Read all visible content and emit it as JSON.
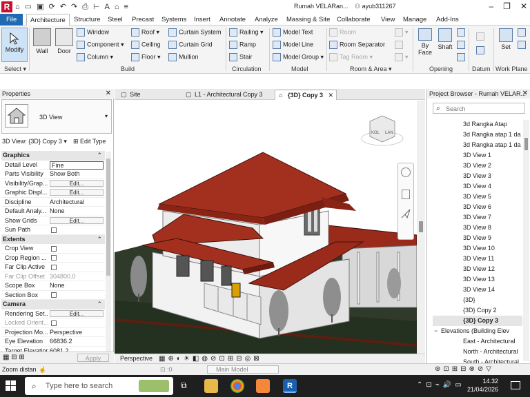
{
  "titlebar": {
    "document_title": "Rumah VELARan...",
    "user": "ayub311267",
    "logo": "R"
  },
  "tabs": [
    "File",
    "Architecture",
    "Structure",
    "Steel",
    "Precast",
    "Systems",
    "Insert",
    "Annotate",
    "Analyze",
    "Massing & Site",
    "Collaborate",
    "View",
    "Manage",
    "Add-Ins"
  ],
  "ribbon": {
    "modify": "Modify",
    "wall": "Wall",
    "door": "Door",
    "window": "Window",
    "component": "Component",
    "column": "Column",
    "roof": "Roof",
    "ceiling": "Ceiling",
    "floor": "Floor",
    "curtain_system": "Curtain System",
    "curtain_grid": "Curtain Grid",
    "mullion": "Mullion",
    "railing": "Railing",
    "ramp": "Ramp",
    "stair": "Stair",
    "model_text": "Model Text",
    "model_line": "Model Line",
    "model_group": "Model Group",
    "room": "Room",
    "room_separator": "Room Separator",
    "tag_room": "Tag Room",
    "by_face": "By Face",
    "shaft": "Shaft",
    "set": "Set",
    "panels": {
      "select": "Select",
      "build": "Build",
      "circulation": "Circulation",
      "model": "Model",
      "room_area": "Room & Area",
      "opening": "Opening",
      "datum": "Datum",
      "work_plane": "Work Plane"
    }
  },
  "properties": {
    "title": "Properties",
    "type_label": "3D View",
    "view_selector": "3D View: {3D} Copy 3",
    "edit_type": "Edit Type",
    "groups": [
      {
        "name": "Graphics",
        "rows": [
          {
            "k": "Detail Level",
            "v": "Fine",
            "kind": "input"
          },
          {
            "k": "Parts Visibility",
            "v": "Show Both"
          },
          {
            "k": "Visibility/Grap...",
            "v": "Edit...",
            "kind": "btn"
          },
          {
            "k": "Graphic Displ...",
            "v": "Edit...",
            "kind": "btn"
          },
          {
            "k": "Discipline",
            "v": "Architectural"
          },
          {
            "k": "Default Analy...",
            "v": "None"
          },
          {
            "k": "Show Grids",
            "v": "Edit...",
            "kind": "btn"
          },
          {
            "k": "Sun Path",
            "v": "",
            "kind": "chk"
          }
        ]
      },
      {
        "name": "Extents",
        "rows": [
          {
            "k": "Crop View",
            "v": "",
            "kind": "chk"
          },
          {
            "k": "Crop Region ...",
            "v": "",
            "kind": "chk"
          },
          {
            "k": "Far Clip Active",
            "v": "",
            "kind": "chk"
          },
          {
            "k": "Far Clip Offset",
            "v": "304800.0",
            "kind": "dim"
          },
          {
            "k": "Scope Box",
            "v": "None"
          },
          {
            "k": "Section Box",
            "v": "",
            "kind": "chk"
          }
        ]
      },
      {
        "name": "Camera",
        "rows": [
          {
            "k": "Rendering Set...",
            "v": "Edit...",
            "kind": "btn"
          },
          {
            "k": "Locked Orient...",
            "v": "",
            "kind": "dimchk"
          },
          {
            "k": "Projection Mo...",
            "v": "Perspective"
          },
          {
            "k": "Eye Elevation",
            "v": "66836.2"
          },
          {
            "k": "Target Elevation",
            "v": "6081.2"
          }
        ]
      }
    ],
    "apply": "Apply"
  },
  "view_tabs": [
    {
      "label": "Site",
      "active": false
    },
    {
      "label": "L1 - Architectural Copy 3",
      "active": false
    },
    {
      "label": "{3D} Copy 3",
      "active": true
    }
  ],
  "view_control": {
    "mode": "Perspective"
  },
  "viewcube": {
    "face_a": "KOL",
    "face_b": "LAN"
  },
  "project_browser": {
    "title": "Project Browser - Rumah VELAR...",
    "search_placeholder": "Search",
    "items": [
      {
        "label": "3d Rangka Atap",
        "indent": 2
      },
      {
        "label": "3d Rangka atap 1 da",
        "indent": 2
      },
      {
        "label": "3d Rangka atap 1 da",
        "indent": 2
      },
      {
        "label": "3D View 1",
        "indent": 2
      },
      {
        "label": "3D View 2",
        "indent": 2
      },
      {
        "label": "3D View 3",
        "indent": 2
      },
      {
        "label": "3D View 4",
        "indent": 2
      },
      {
        "label": "3D View 5",
        "indent": 2
      },
      {
        "label": "3D View 6",
        "indent": 2
      },
      {
        "label": "3D View 7",
        "indent": 2
      },
      {
        "label": "3D View 8",
        "indent": 2
      },
      {
        "label": "3D View 9",
        "indent": 2
      },
      {
        "label": "3D View 10",
        "indent": 2
      },
      {
        "label": "3D View 11",
        "indent": 2
      },
      {
        "label": "3D View 12",
        "indent": 2
      },
      {
        "label": "3D View 13",
        "indent": 2
      },
      {
        "label": "3D View 14",
        "indent": 2
      },
      {
        "label": "{3D}",
        "indent": 2
      },
      {
        "label": "{3D} Copy 2",
        "indent": 2
      },
      {
        "label": "{3D} Copy 3",
        "indent": 2,
        "selected": true
      },
      {
        "label": "Elevations (Building Elev",
        "indent": 1,
        "expander": "−"
      },
      {
        "label": "East - Architectural",
        "indent": 2
      },
      {
        "label": "North - Architectural",
        "indent": 2
      },
      {
        "label": "South - Architectural",
        "indent": 2
      }
    ]
  },
  "status": {
    "left": "Zoom distan",
    "zero": ":0",
    "model": "Main Model"
  },
  "taskbar": {
    "search_placeholder": "Type here to search",
    "time": "14.32",
    "date": "21/04/2026"
  }
}
